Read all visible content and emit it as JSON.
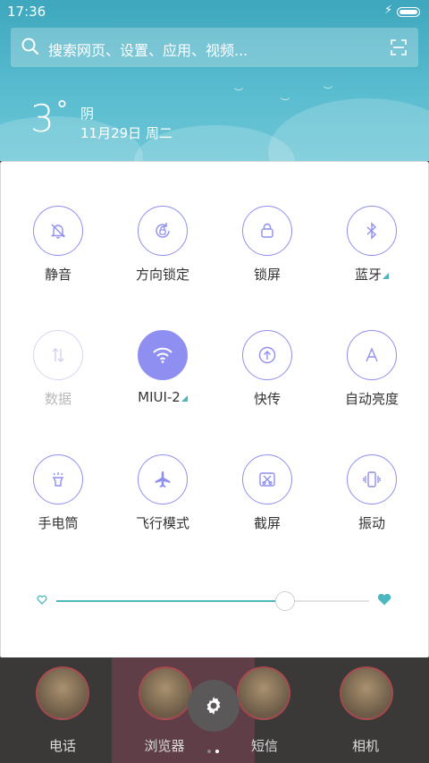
{
  "status_bar": {
    "time": "17:36"
  },
  "search": {
    "placeholder": "搜索网页、设置、应用、视频..."
  },
  "weather": {
    "temperature": "3",
    "degree_symbol": "°",
    "condition": "阴",
    "date": "11月29日 周二"
  },
  "colors": {
    "accent": "#8f8ff2",
    "teal": "#4bb8bf",
    "sky": "#4fb3c6"
  },
  "toggles": [
    {
      "label": "静音",
      "icon": "bell-off-icon",
      "state": "off"
    },
    {
      "label": "方向锁定",
      "icon": "rotation-lock-icon",
      "state": "off"
    },
    {
      "label": "锁屏",
      "icon": "lock-icon",
      "state": "off"
    },
    {
      "label": "蓝牙",
      "icon": "bluetooth-icon",
      "state": "off"
    },
    {
      "label": "数据",
      "icon": "mobile-data-icon",
      "state": "disabled"
    },
    {
      "label": "MIUI-2",
      "icon": "wifi-icon",
      "state": "on"
    },
    {
      "label": "快传",
      "icon": "upload-icon",
      "state": "off"
    },
    {
      "label": "自动亮度",
      "icon": "auto-brightness-icon",
      "state": "off"
    },
    {
      "label": "手电筒",
      "icon": "flashlight-icon",
      "state": "off"
    },
    {
      "label": "飞行模式",
      "icon": "airplane-icon",
      "state": "off"
    },
    {
      "label": "截屏",
      "icon": "screenshot-icon",
      "state": "off"
    },
    {
      "label": "振动",
      "icon": "vibrate-icon",
      "state": "off"
    }
  ],
  "brightness": {
    "value": 0.73
  },
  "dock": {
    "apps": [
      "电话",
      "浏览器",
      "短信",
      "相机"
    ]
  }
}
